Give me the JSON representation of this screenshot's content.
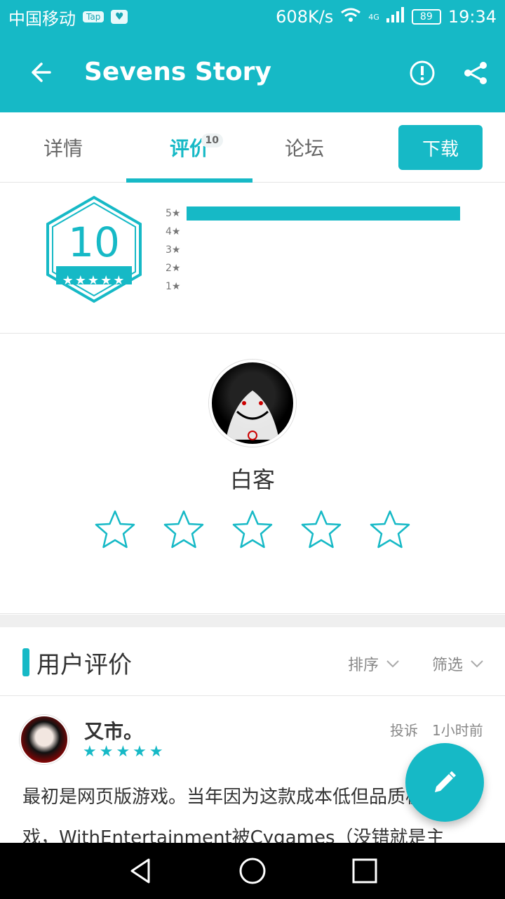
{
  "status": {
    "carrier": "中国移动",
    "chip_tap": "Tap",
    "network_speed": "608K/s",
    "signal_tag": "4G",
    "battery": "89",
    "time": "19:34"
  },
  "appbar": {
    "title": "Sevens Story"
  },
  "tabs": [
    {
      "label": "详情"
    },
    {
      "label": "评价",
      "badge": "10"
    },
    {
      "label": "论坛"
    }
  ],
  "download_label": "下载",
  "summary": {
    "score": "10",
    "bars": [
      {
        "label": "5★",
        "fraction": 1.0
      },
      {
        "label": "4★",
        "fraction": 0.0
      },
      {
        "label": "3★",
        "fraction": 0.0
      },
      {
        "label": "2★",
        "fraction": 0.0
      },
      {
        "label": "1★",
        "fraction": 0.0
      }
    ]
  },
  "my_rating": {
    "username": "白客",
    "selected_stars": 0
  },
  "reviews": {
    "title": "用户评价",
    "sort_label": "排序",
    "filter_label": "筛选",
    "items": [
      {
        "name": "又市。",
        "rating_stars": "★★★★★",
        "report_label": "投诉",
        "time": "1小时前",
        "text": "最初是网页版游戏。当年因为这款成本低但品质极高的游戏，WithEntertainment被Cygames（没错就是主"
      }
    ]
  },
  "colors": {
    "accent": "#16b9c6"
  }
}
